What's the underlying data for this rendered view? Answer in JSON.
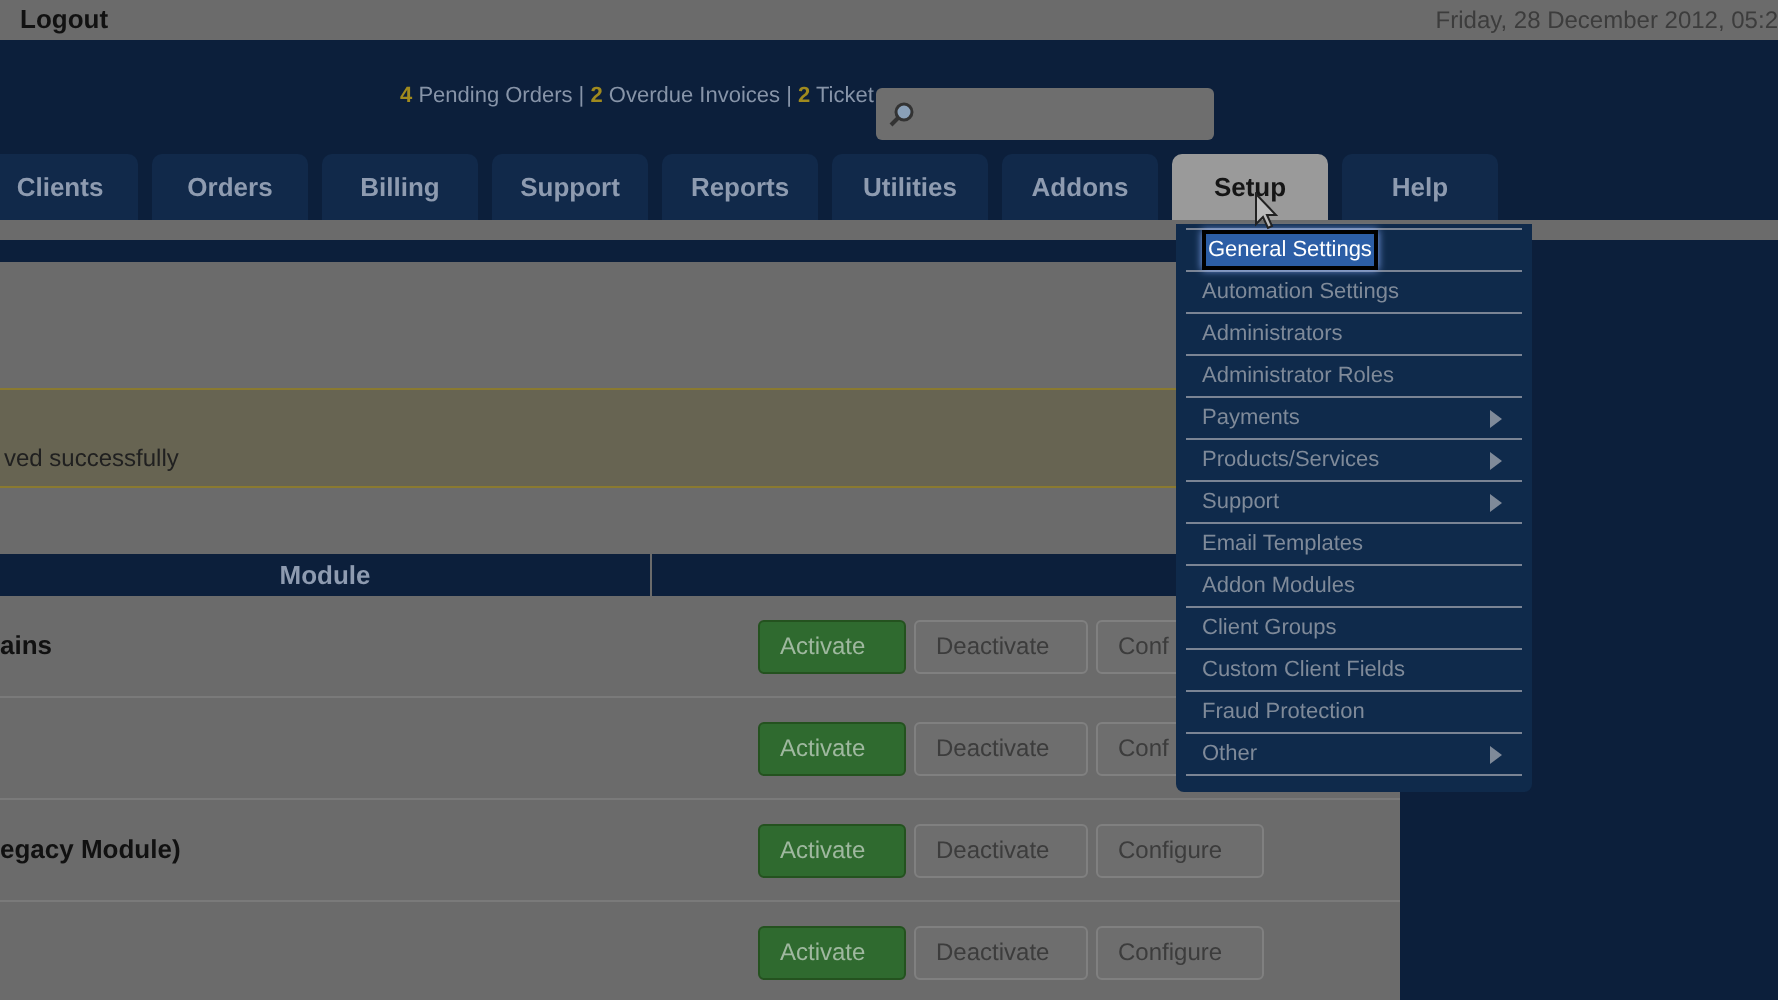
{
  "top_bar": {
    "logout": "Logout",
    "date": "Friday, 28 December 2012, 05:2"
  },
  "notice": [
    {
      "count": "4",
      "label": "Pending Orders"
    },
    {
      "count": "2",
      "label": "Overdue Invoices"
    },
    {
      "count": "2",
      "label": "Ticket"
    }
  ],
  "notice_separator": "|",
  "tabs": [
    {
      "label": "Clients",
      "selected": false
    },
    {
      "label": "Orders",
      "selected": false
    },
    {
      "label": "Billing",
      "selected": false
    },
    {
      "label": "Support",
      "selected": false
    },
    {
      "label": "Reports",
      "selected": false
    },
    {
      "label": "Utilities",
      "selected": false
    },
    {
      "label": "Addons",
      "selected": false
    },
    {
      "label": "Setup",
      "selected": true
    },
    {
      "label": "Help",
      "selected": false
    }
  ],
  "setup_menu": [
    {
      "label": "General Settings",
      "selected": true,
      "submenu": false
    },
    {
      "label": "Automation Settings",
      "selected": false,
      "submenu": false
    },
    {
      "label": "Administrators",
      "selected": false,
      "submenu": false
    },
    {
      "label": "Administrator Roles",
      "selected": false,
      "submenu": false
    },
    {
      "label": "Payments",
      "selected": false,
      "submenu": true
    },
    {
      "label": "Products/Services",
      "selected": false,
      "submenu": true
    },
    {
      "label": "Support",
      "selected": false,
      "submenu": true
    },
    {
      "label": "Email Templates",
      "selected": false,
      "submenu": false
    },
    {
      "label": "Addon Modules",
      "selected": false,
      "submenu": false
    },
    {
      "label": "Client Groups",
      "selected": false,
      "submenu": false
    },
    {
      "label": "Custom Client Fields",
      "selected": false,
      "submenu": false
    },
    {
      "label": "Fraud Protection",
      "selected": false,
      "submenu": false
    },
    {
      "label": "Other",
      "selected": false,
      "submenu": true
    }
  ],
  "message": "ved successfully",
  "table": {
    "columns": [
      "Module"
    ],
    "rows": [
      {
        "name": "ains",
        "buttons": [
          "Activate",
          "Deactivate",
          "Conf"
        ]
      },
      {
        "buttons": [
          "Activate",
          "Deactivate",
          "Conf"
        ]
      },
      {
        "name": "egacy Module)",
        "buttons": [
          "Activate",
          "Deactivate",
          "Configure"
        ]
      },
      {
        "buttons": [
          "Activate",
          "Deactivate",
          "Configure"
        ]
      }
    ]
  }
}
